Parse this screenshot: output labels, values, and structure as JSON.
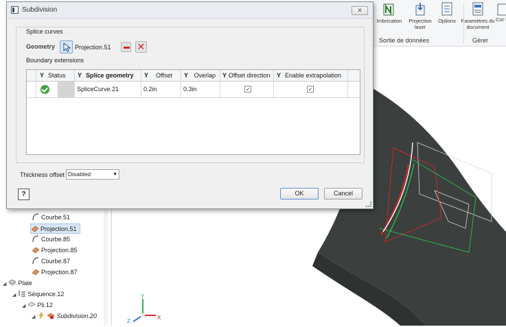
{
  "dialog": {
    "title": "Subdivision",
    "close_glyph": "✕",
    "splice_curves_label": "Splice curves",
    "geometry_label": "Geometry",
    "geometry_value": "Projection.51",
    "boundary_extensions_label": "Boundary extensions",
    "table": {
      "columns": [
        "Status",
        "Splice geometry",
        "Offset",
        "Overlap",
        "Offset direction",
        "Enable extrapolation"
      ],
      "rows": [
        {
          "status": "ok",
          "splice_geometry": "SpliceCurve.21",
          "offset": "0.2in",
          "overlap": "0.3in",
          "offset_direction": true,
          "enable_extrapolation": true
        }
      ]
    },
    "thickness_offset_label": "Thickness offset",
    "thickness_offset_value": "Disabled",
    "help_glyph": "?",
    "ok_label": "OK",
    "cancel_label": "Cancel"
  },
  "ribbon": {
    "buttons": [
      {
        "label": "Imbrication",
        "icon": "nesting-icon"
      },
      {
        "label": "Projection laser",
        "icon": "laser-projection-icon"
      },
      {
        "label": "Options",
        "icon": "options-icon"
      },
      {
        "label": "Paramètres du document",
        "icon": "document-settings-icon"
      },
      {
        "label": "Cor L",
        "icon": "partial-icon"
      }
    ],
    "groups": [
      "Sortie de données",
      "Gérer"
    ]
  },
  "browser": {
    "items": [
      {
        "label": "Courbe.51",
        "icon": "curve-icon"
      },
      {
        "label": "Projection.51",
        "icon": "projection-icon",
        "selected": true
      },
      {
        "label": "Courbe.85",
        "icon": "curve-icon"
      },
      {
        "label": "Projection.85",
        "icon": "projection-icon"
      },
      {
        "label": "Courbe.87",
        "icon": "curve-icon"
      },
      {
        "label": "Projection.87",
        "icon": "projection-icon"
      },
      {
        "label": "Plate",
        "icon": "plate-icon"
      },
      {
        "label": "Séquence.12",
        "icon": "sequence-icon"
      },
      {
        "label": "Pli.12",
        "icon": "ply-icon"
      },
      {
        "label": "Subdivision.20",
        "icon": "subdivision-icon"
      }
    ]
  },
  "axis_labels": {
    "x": "X",
    "y": "Y",
    "z": "Z"
  },
  "colors": {
    "viewport_bg": "#ffffff",
    "surface": "#3b3f3e",
    "curve_red": "#cc2a2a",
    "curve_green": "#2bb54a",
    "accent_blue": "#3a7bd5"
  }
}
